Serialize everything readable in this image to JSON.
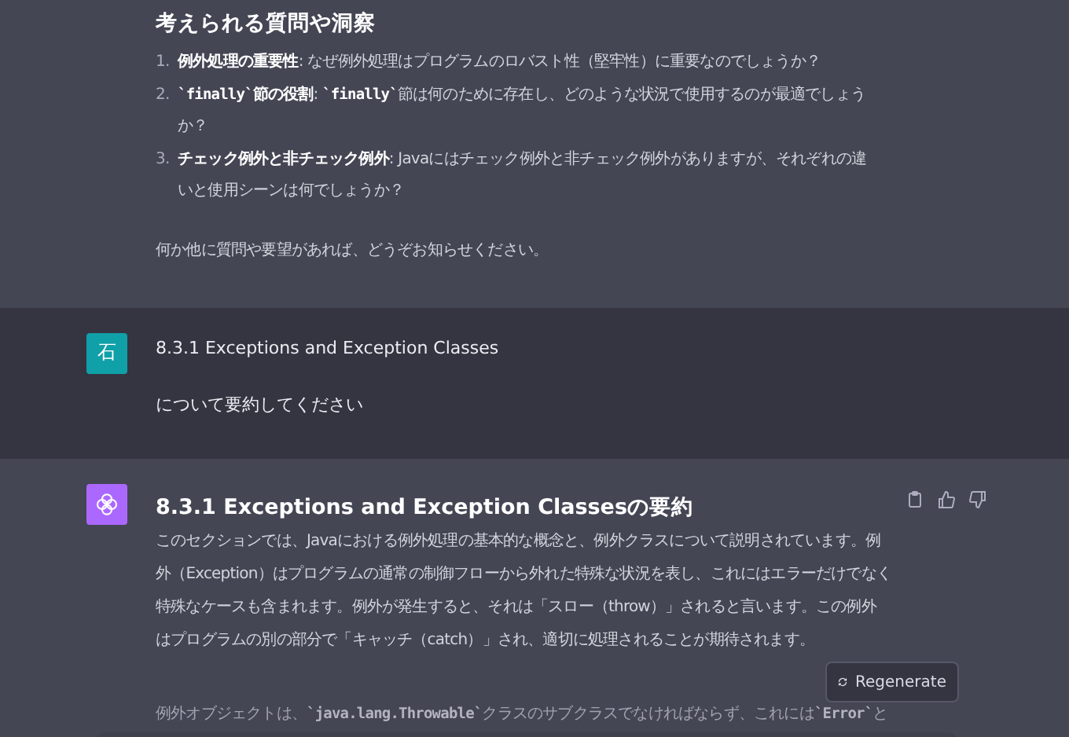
{
  "messages": [
    {
      "kind": "assistant",
      "heading": "考えられる質問や洞察",
      "list": [
        {
          "number": "1.",
          "segments": [
            {
              "kind": "bold",
              "text": "例外処理の重要性"
            },
            {
              "kind": "plain",
              "text": ": なぜ例外処理はプログラムのロバスト性（堅牢性）に重要なのでしょうか？"
            }
          ]
        },
        {
          "number": "2.",
          "segments": [
            {
              "kind": "code",
              "text": "`finally`"
            },
            {
              "kind": "bold",
              "text": "節の役割"
            },
            {
              "kind": "plain",
              "text": ": "
            },
            {
              "kind": "code",
              "text": "`finally`"
            },
            {
              "kind": "plain",
              "text": "節は何のために存在し、どのような状況で使用するのが最適でしょうか？"
            }
          ]
        },
        {
          "number": "3.",
          "segments": [
            {
              "kind": "bold",
              "text": "チェック例外と非チェック例外"
            },
            {
              "kind": "plain",
              "text": ": Javaにはチェック例外と非チェック例外がありますが、それぞれの違いと使用シーンは何でしょうか？"
            }
          ]
        }
      ],
      "paragraphs": [
        [
          {
            "kind": "plain",
            "text": "何か他に質問や要望があれば、どうぞお知らせください。"
          }
        ]
      ]
    },
    {
      "kind": "user",
      "avatar": "石",
      "lines": [
        "8.3.1  Exceptions and Exception Classes",
        "について要約してください"
      ]
    },
    {
      "kind": "assistant",
      "avatar": true,
      "actions": true,
      "heading": "8.3.1 Exceptions and Exception Classesの要約",
      "paragraphs": [
        [
          {
            "kind": "plain",
            "text": "このセクションでは、Javaにおける例外処理の基本的な概念と、例外クラスについて説明されています。例外（Exception）はプログラムの通常の制御フローから外れた特殊な状況を表し、これにはエラーだけでなく特殊なケースも含まれます。例外が発生すると、それは「スロー（throw）」されると言います。この例外はプログラムの別の部分で「キャッチ（catch）」され、適切に処理されることが期待されます。"
          }
        ],
        [
          {
            "kind": "plain",
            "text": "例外オブジェクトは、"
          },
          {
            "kind": "code",
            "text": "`java.lang.Throwable`"
          },
          {
            "kind": "plain",
            "text": "クラスのサブクラスでなければならず、これには"
          },
          {
            "kind": "code",
            "text": "`Error`"
          },
          {
            "kind": "plain",
            "text": "と"
          }
        ]
      ]
    }
  ],
  "regenerate": "Regenerate"
}
